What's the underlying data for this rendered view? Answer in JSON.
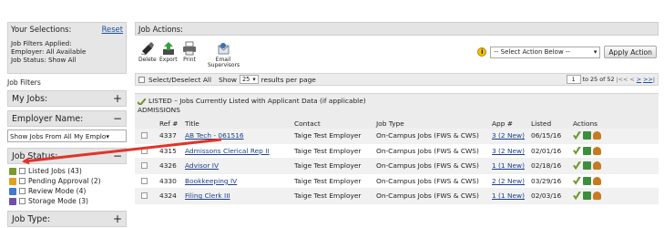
{
  "sidebar": {
    "selections_title": "Your Selections:",
    "reset_label": "Reset",
    "applied_lines": [
      "Job Filters Applied:",
      "Employer: All Available",
      "Job Status: Show All"
    ],
    "job_filters_title": "Job Filters",
    "my_jobs_label": "My Jobs:",
    "my_jobs_sign": "+",
    "employer_label": "Employer Name:",
    "employer_sign": "−",
    "employer_select_value": "Show Jobs From All My Emplo▾",
    "job_status_label": "Job Status:",
    "job_status_sign": "−",
    "status_items": [
      {
        "label": "Listed Jobs (43)",
        "icon": "person-check-icon",
        "color": "#7a9a2b"
      },
      {
        "label": "Pending Approval (2)",
        "icon": "clipboard-icon",
        "color": "#e0a020"
      },
      {
        "label": "Review Mode (4)",
        "icon": "review-arrow-icon",
        "color": "#3f7ad1"
      },
      {
        "label": "Storage Mode (3)",
        "icon": "storage-box-icon",
        "color": "#6f4fae"
      }
    ],
    "job_type_label": "Job Type:",
    "job_type_sign": "+"
  },
  "main": {
    "actions_title": "Job Actions:",
    "tools": [
      {
        "label": "Delete",
        "icon": "delete-icon"
      },
      {
        "label": "Export",
        "icon": "export-icon"
      },
      {
        "label": "Print",
        "icon": "print-icon"
      },
      {
        "label": "Email Supervisors",
        "icon": "email-icon"
      }
    ],
    "action_select_value": "-- Select Action Below --",
    "apply_label": "Apply Action",
    "select_all_label": "Select/Deselect All",
    "show_label": "Show",
    "show_value": "25",
    "per_page_label": "results per page",
    "pager": {
      "page_input": "1",
      "range_text": "to 25 of 52",
      "first": "|<<",
      "prev": "<",
      "next": ">",
      "last": ">>|"
    },
    "listed_title": "LISTED – Jobs Currently Listed with Applicant Data (if applicable)",
    "listed_subtitle": "ADMISSIONS",
    "columns": {
      "id": "Ref #",
      "title": "Title",
      "contact": "Contact",
      "type": "Job Type",
      "app": "App #",
      "listed": "Listed",
      "actions": "Actions"
    },
    "rows": [
      {
        "id": "4337",
        "title": "AB Tech - 061516",
        "contact": "Taige Test Employer",
        "type": "On-Campus Jobs (FWS & CWS)",
        "app": "3 (2 New)",
        "listed": "06/15/16"
      },
      {
        "id": "4315",
        "title": "Admissons Clerical Rep II",
        "contact": "Taige Test Employer",
        "type": "On-Campus Jobs (FWS & CWS)",
        "app": "3 (2 New)",
        "listed": "02/01/16"
      },
      {
        "id": "4326",
        "title": "Advisor IV",
        "contact": "Taige Test Employer",
        "type": "On-Campus Jobs (FWS & CWS)",
        "app": "1 (1 New)",
        "listed": "02/18/16"
      },
      {
        "id": "4330",
        "title": "Bookkeeping IV",
        "contact": "Taige Test Employer",
        "type": "On-Campus Jobs (FWS & CWS)",
        "app": "2 (2 New)",
        "listed": "03/29/16"
      },
      {
        "id": "4324",
        "title": "Filing Clerk III",
        "contact": "Taige Test Employer",
        "type": "On-Campus Jobs (FWS & CWS)",
        "app": "1 (1 New)",
        "listed": "02/03/16"
      }
    ]
  },
  "colors": {
    "panel_bg": "#e4e4e4",
    "link": "#1a3f8c",
    "annotation_arrow": "#e0342b"
  }
}
